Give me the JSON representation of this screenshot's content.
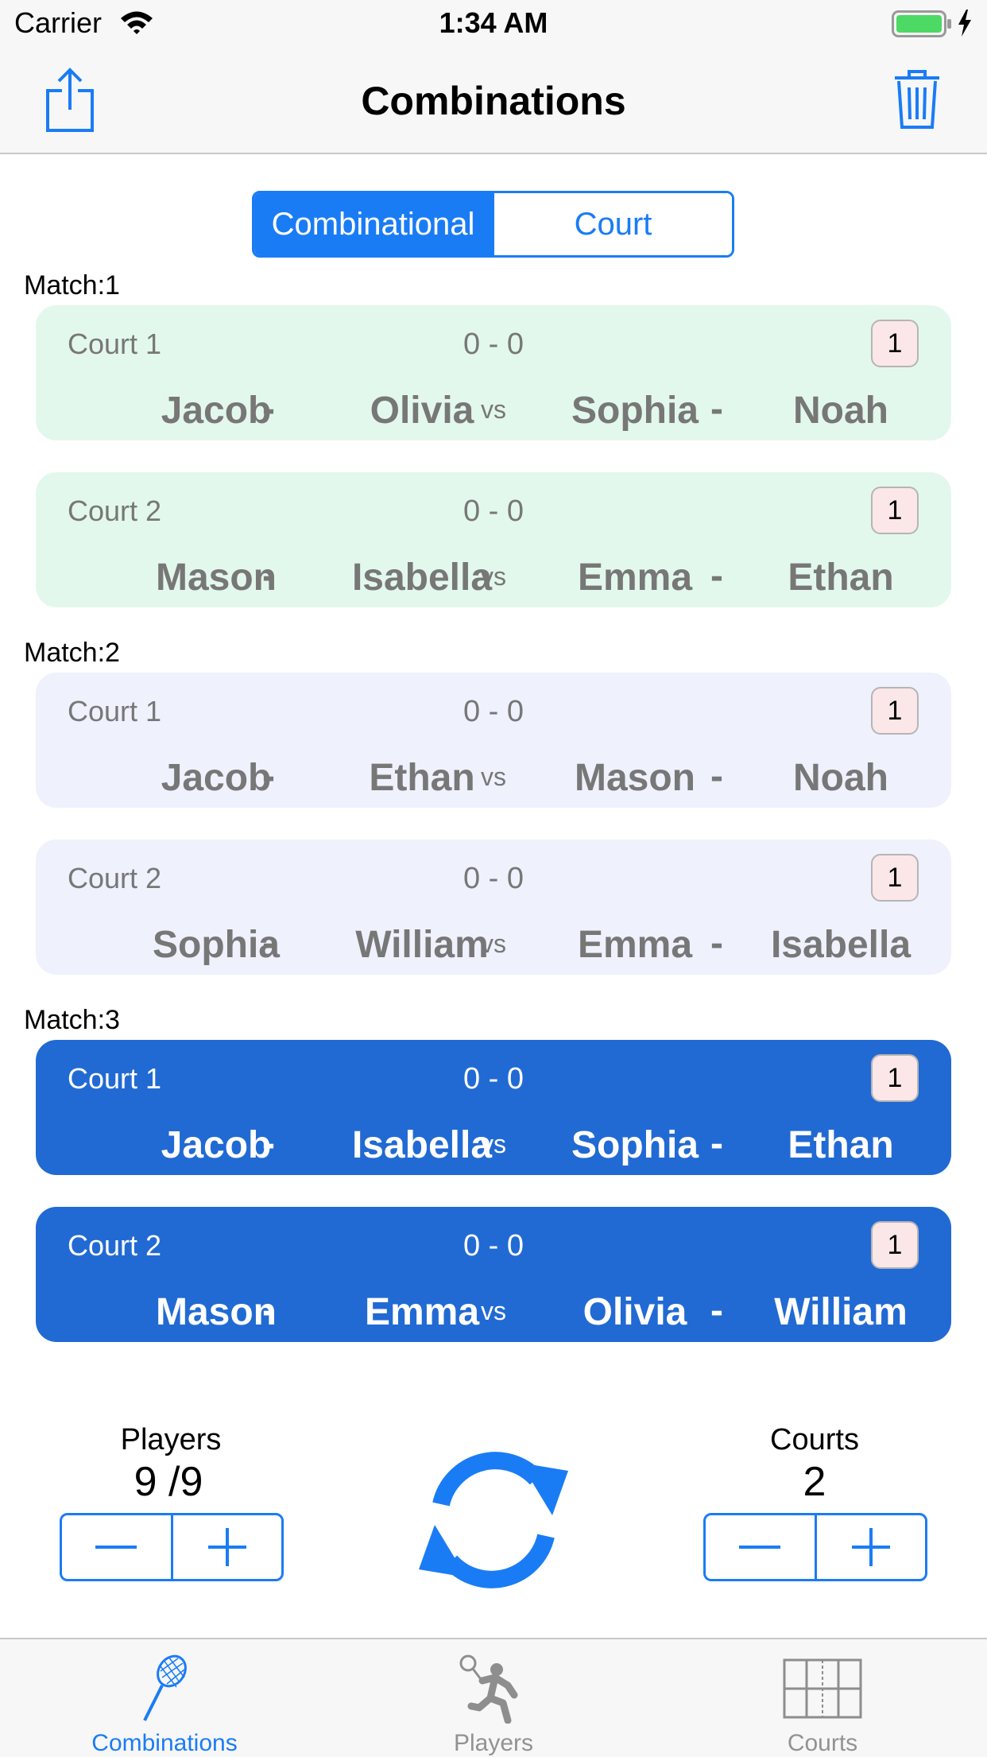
{
  "status_bar": {
    "carrier": "Carrier",
    "time": "1:34 AM"
  },
  "nav": {
    "title": "Combinations",
    "left_icon": "share-icon",
    "right_icon": "trash-icon"
  },
  "segment": {
    "options": [
      "Combinational",
      "Court"
    ],
    "selected": "Combinational"
  },
  "matches": [
    {
      "label": "Match:1",
      "courts": [
        {
          "court": "Court 1",
          "score": "0 - 0",
          "badge": "1",
          "team1": [
            "Jacob",
            "Olivia"
          ],
          "team2": [
            "Sophia",
            "Noah"
          ]
        },
        {
          "court": "Court 2",
          "score": "0 - 0",
          "badge": "1",
          "team1": [
            "Mason",
            "Isabella"
          ],
          "team2": [
            "Emma",
            "Ethan"
          ]
        }
      ]
    },
    {
      "label": "Match:2",
      "courts": [
        {
          "court": "Court 1",
          "score": "0 - 0",
          "badge": "1",
          "team1": [
            "Jacob",
            "Ethan"
          ],
          "team2": [
            "Mason",
            "Noah"
          ]
        },
        {
          "court": "Court 2",
          "score": "0 - 0",
          "badge": "1",
          "team1": [
            "Sophia",
            "William"
          ],
          "team2": [
            "Emma",
            "Isabella"
          ]
        }
      ]
    },
    {
      "label": "Match:3",
      "courts": [
        {
          "court": "Court 1",
          "score": "0 - 0",
          "badge": "1",
          "team1": [
            "Jacob",
            "Isabella"
          ],
          "team2": [
            "Sophia",
            "Ethan"
          ]
        },
        {
          "court": "Court 2",
          "score": "0 - 0",
          "badge": "1",
          "team1": [
            "Mason",
            "Emma"
          ],
          "team2": [
            "Olivia",
            "William"
          ]
        }
      ]
    }
  ],
  "sep": {
    "dash": "-",
    "vs": "vs"
  },
  "colors": {
    "match1_bg": "#e3f8ec",
    "match2_bg": "#eff1fd",
    "match3_bg": "#216ad3",
    "accent": "#1a7cf5",
    "badge_bg": "#fbe6e8"
  },
  "controls": {
    "players": {
      "label": "Players",
      "value": "9 /9"
    },
    "courts": {
      "label": "Courts",
      "value": "2"
    },
    "refresh_icon": "refresh-icon"
  },
  "tabs": [
    {
      "label": "Combinations",
      "icon": "racket-icon",
      "active": true
    },
    {
      "label": "Players",
      "icon": "player-icon",
      "active": false
    },
    {
      "label": "Courts",
      "icon": "court-icon",
      "active": false
    }
  ]
}
